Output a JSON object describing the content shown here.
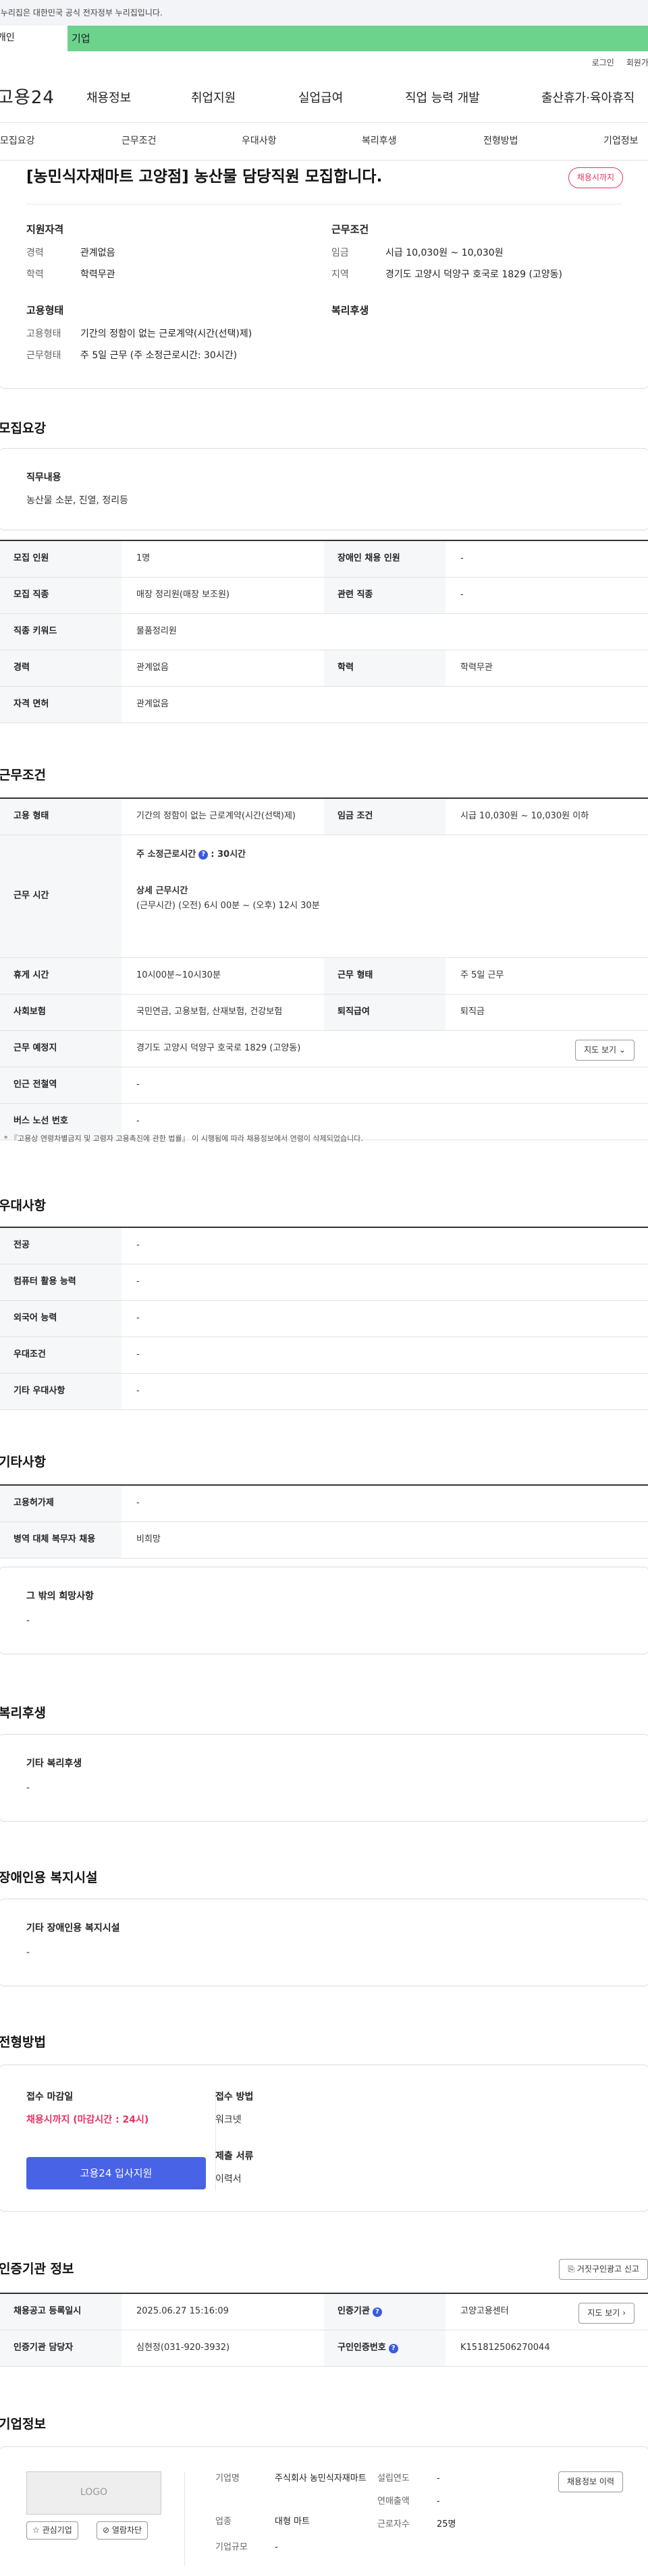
{
  "gov_banner": "이 누리집은 대한민국 공식 전자정부 누리집입니다.",
  "top_tabs": {
    "personal": "개인",
    "company": "기업"
  },
  "util": {
    "login": "로그인",
    "join": "회원가입"
  },
  "gnb": {
    "logo": "고용24",
    "menu": [
      "채용정보",
      "취업지원",
      "실업급여",
      "직업 능력 개발",
      "출산휴가·육아휴직"
    ]
  },
  "anchor_tabs": [
    "모집요강",
    "근무조건",
    "우대사항",
    "복리후생",
    "전형방법",
    "기업정보"
  ],
  "summary": {
    "title": "[농민식자재마트 고양점] 농산물 담당직원 모집합니다.",
    "badge": "채용시까지",
    "qual_head": "지원자격",
    "qual": [
      {
        "k": "경력",
        "v": "관계없음"
      },
      {
        "k": "학력",
        "v": "학력무관"
      }
    ],
    "cond_head": "근무조건",
    "cond": [
      {
        "k": "임금",
        "v": "시급 10,030원 ~ 10,030원"
      },
      {
        "k": "지역",
        "v": "경기도 고양시 덕양구 호국로 1829 (고양동)"
      }
    ],
    "emp_head": "고용형태",
    "emp": [
      {
        "k": "고용형태",
        "v": "기간의 정함이 없는 근로계약(시간(선택)제)"
      },
      {
        "k": "근무형태",
        "v": "주 5일 근무 (주 소정근로시간: 30시간)"
      }
    ],
    "welfare_head": "복리후생"
  },
  "recruit": {
    "title": "모집요강",
    "duty_head": "직무내용",
    "duty": "농산물 소분, 진열, 정리등",
    "rows": [
      {
        "k1": "모집 인원",
        "v1": "1명",
        "k2": "장애인 채용 인원",
        "v2": "-"
      },
      {
        "k1": "모집 직종",
        "v1": "매장 정리원(매장 보조원)",
        "k2": "관련 직종",
        "v2": "-"
      }
    ],
    "keyword_k": "직종 키워드",
    "keyword_v": "물품정리원",
    "career_k": "경력",
    "career_v": "관계없음",
    "edu_k": "학력",
    "edu_v": "학력무관",
    "license_k": "자격 면허",
    "license_v": "관계없음"
  },
  "work": {
    "title": "근무조건",
    "emp_k": "고용 형태",
    "emp_v": "기간의 정함이 없는 근로계약(시간(선택)제)",
    "wage_k": "임금 조건",
    "wage_v": "시급 10,030원 ~ 10,030원 이하",
    "time_k": "근무 시간",
    "weekly_label": "주 소정근로시간",
    "weekly_value": ": 30시간",
    "detail_label": "상세 근무시간",
    "detail_value": "(근무시간) (오전) 6시 00분 ~ (오후) 12시 30분",
    "break_k": "휴게 시간",
    "break_v": "10시00분~10시30분",
    "form_k": "근무 형태",
    "form_v": "주 5일 근무",
    "ins_k": "사회보험",
    "ins_v": "국민연금, 고용보험, 산재보험, 건강보험",
    "ret_k": "퇴직급여",
    "ret_v": "퇴직금",
    "place_k": "근무 예정지",
    "place_v": "경기도 고양시 덕양구 호국로 1829 (고양동)",
    "map_btn": "지도 보기",
    "subway_k": "인근 전철역",
    "subway_v": "-",
    "bus_k": "버스 노선 번호",
    "bus_v": "-",
    "note": "* 『고용상 연령차별금지 및 고령자 고용촉진에 관한 법률』 이 시행됨에 따라 채용정보에서 연령이 삭제되었습니다."
  },
  "pref": {
    "title": "우대사항",
    "rows": [
      {
        "k": "전공",
        "v": "-"
      },
      {
        "k": "컴퓨터 활용 능력",
        "v": "-"
      },
      {
        "k": "외국어 능력",
        "v": "-"
      },
      {
        "k": "우대조건",
        "v": "-"
      },
      {
        "k": "기타 우대사항",
        "v": "-"
      }
    ]
  },
  "etc": {
    "title": "기타사항",
    "rows": [
      {
        "k": "고용허가제",
        "v": "-"
      },
      {
        "k": "병역 대체 복무자 채용",
        "v": "비희망"
      }
    ],
    "other_head": "그 밖의 희망사항",
    "other_v": "-"
  },
  "welfare": {
    "title": "복리후생",
    "head": "기타 복리후생",
    "v": "-"
  },
  "disability": {
    "title": "장애인용 복지시설",
    "head": "기타 장애인용 복지시설",
    "v": "-"
  },
  "process": {
    "title": "전형방법",
    "deadline_head": "접수 마감일",
    "deadline_v": "채용시까지 (마감시간 : 24시)",
    "method_head": "접수 방법",
    "method_v": "워크넷",
    "docs_head": "제출 서류",
    "docs_v": "이력서",
    "apply_btn": "고용24 입사지원"
  },
  "agency": {
    "title": "인증기관 정보",
    "report_btn": "거짓구인광고 신고",
    "reg_k": "채용공고 등록일시",
    "reg_v": "2025.06.27 15:16:09",
    "org_k": "인증기관",
    "org_v": "고양고용센터",
    "map_btn": "지도 보기",
    "mgr_k": "인증기관 담당자",
    "mgr_v": "심현정(031-920-3932)",
    "no_k": "구인인증번호",
    "no_v": "K151812506270044"
  },
  "company": {
    "title": "기업정보",
    "logo": "LOGO",
    "fav_btn": "관심기업",
    "block_btn": "열람차단",
    "name_k": "기업명",
    "name_v": "주식회사 농민식자재마트",
    "type_k": "업종",
    "type_v": "대형 마트",
    "size_k": "기업규모",
    "size_v": "-",
    "est_k": "설립연도",
    "est_v": "-",
    "sales_k": "연매출액",
    "sales_v": "-",
    "emp_k": "근로자수",
    "emp_v": "25명",
    "history_btn": "채용정보 이력"
  },
  "colors": {
    "accent_green": "#6bd38c",
    "accent_blue": "#4863e6",
    "accent_red": "#e73364"
  }
}
